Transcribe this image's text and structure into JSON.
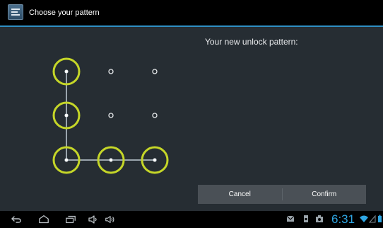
{
  "titlebar": {
    "title": "Choose your pattern",
    "icon": "settings-app-icon"
  },
  "pattern": {
    "header": "Your new unlock pattern:",
    "grid": [
      [
        1,
        2,
        3
      ],
      [
        4,
        5,
        6
      ],
      [
        7,
        8,
        9
      ]
    ],
    "selected_cells": [
      1,
      4,
      7,
      8,
      9
    ],
    "path_order": [
      1,
      4,
      7,
      8,
      9
    ]
  },
  "buttons": {
    "cancel_label": "Cancel",
    "confirm_label": "Confirm"
  },
  "statusbar": {
    "time": "6:31",
    "icons": [
      "back-icon",
      "home-icon",
      "recent-apps-icon",
      "volume-down-icon",
      "volume-up-icon",
      "gmail-icon",
      "sd-card-icon",
      "screenshot-icon",
      "wifi-icon",
      "signal-icon",
      "battery-icon"
    ]
  },
  "colors": {
    "accent": "#2f8fc4",
    "pattern_ring": "#c5d628",
    "clock": "#2fa6e3"
  }
}
